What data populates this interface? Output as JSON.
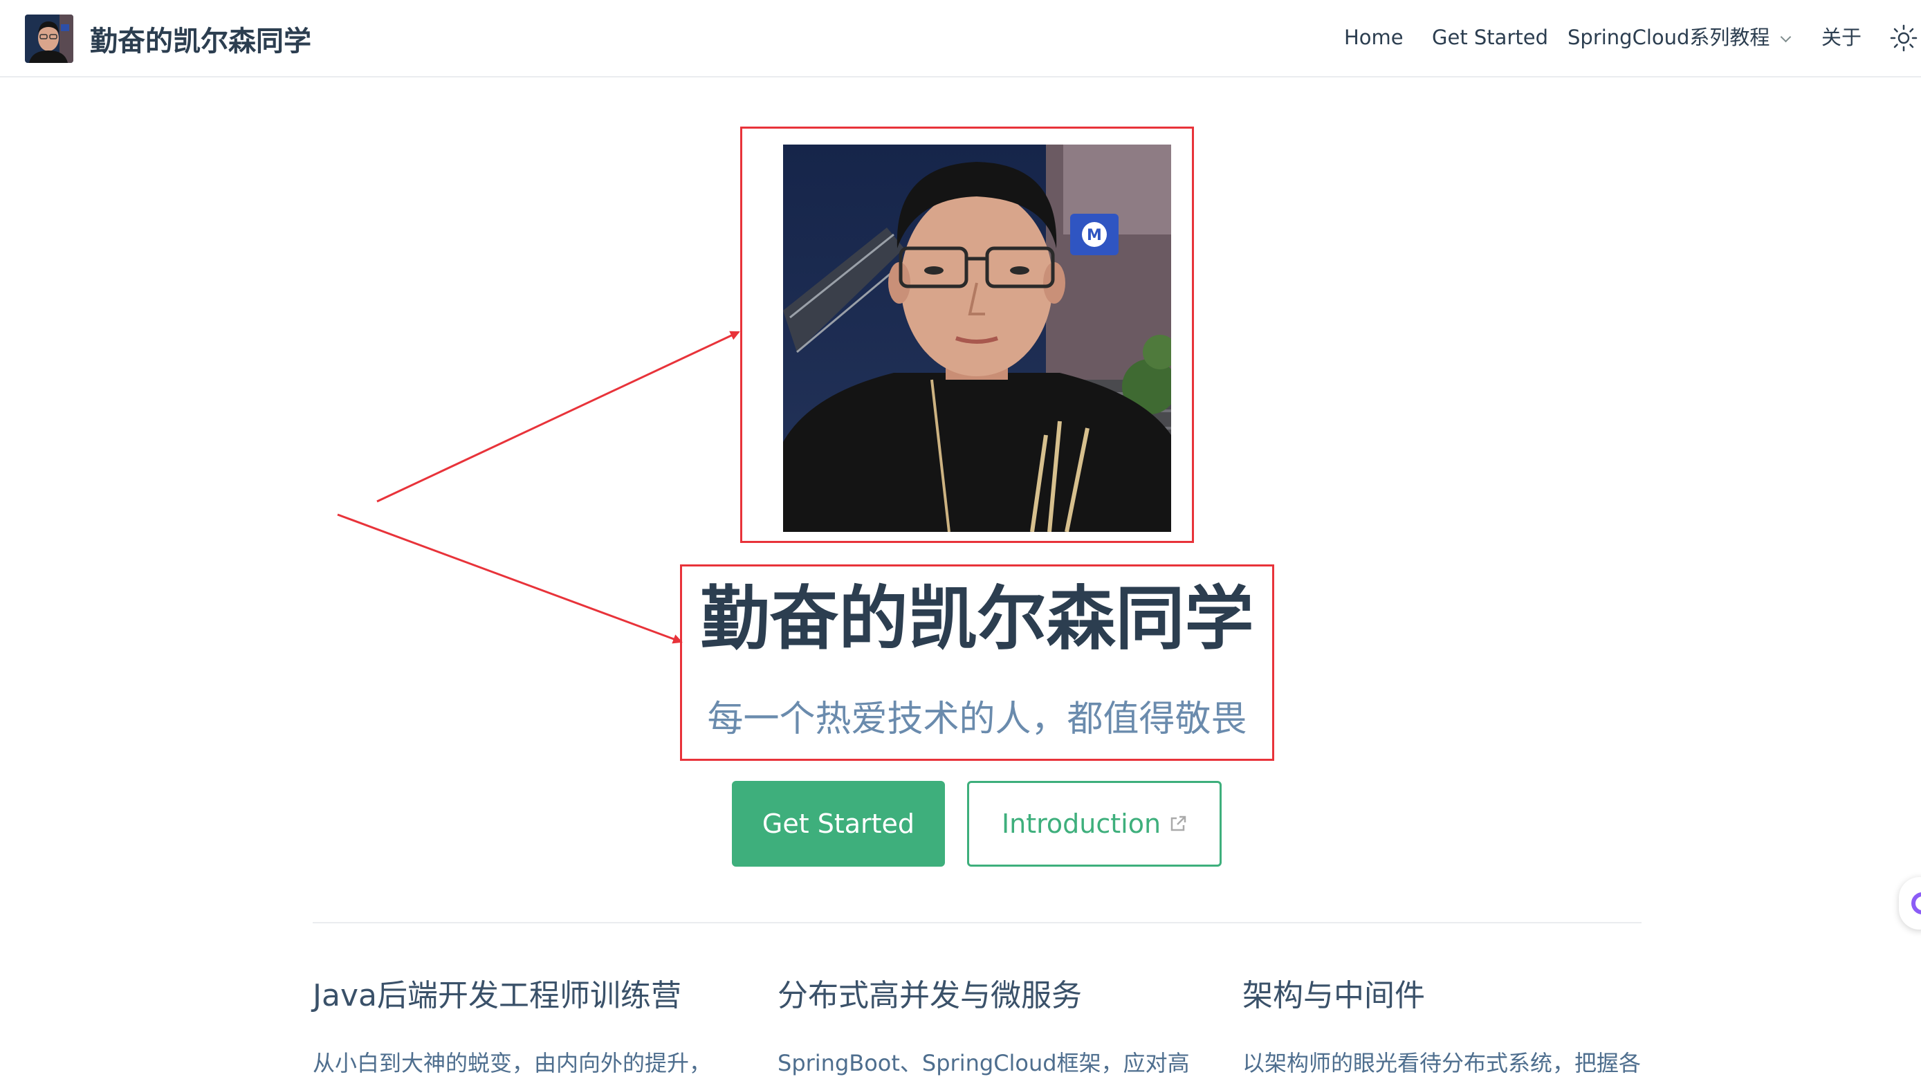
{
  "navbar": {
    "site_name": "勤奋的凯尔森同学",
    "links": {
      "home": "Home",
      "get_started": "Get Started",
      "springcloud": "SpringCloud系列教程",
      "about": "关于"
    },
    "icons": {
      "dropdown": "chevron-down-icon",
      "theme": "sun-icon"
    }
  },
  "hero": {
    "title": "勤奋的凯尔森同学",
    "description": "每一个热爱技术的人，都值得敬畏",
    "actions": {
      "primary": "Get Started",
      "secondary": "Introduction"
    }
  },
  "features": [
    {
      "title": "Java后端开发工程师训练营",
      "details": "从小白到大神的蜕变，由内向外的提升，"
    },
    {
      "title": "分布式高并发与微服务",
      "details": "SpringBoot、SpringCloud框架，应对高"
    },
    {
      "title": "架构与中间件",
      "details": "以架构师的眼光看待分布式系统，把握各"
    }
  ],
  "colors": {
    "accent": "#3eaf7c",
    "annotation": "#e8333a",
    "text": "#2c3e50",
    "description": "#6a8bad"
  }
}
